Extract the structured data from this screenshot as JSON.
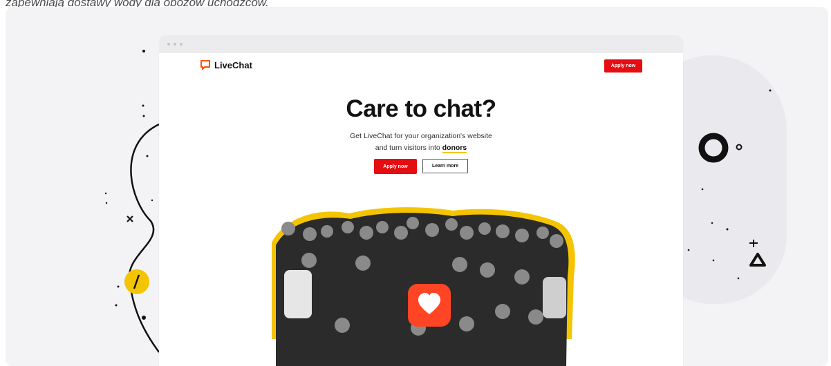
{
  "caption": "zapewniają dostawy wody dla obozów uchodźców.",
  "browser": {
    "logo_text": "LiveChat",
    "header_cta": "Apply now"
  },
  "hero": {
    "title": "Care to chat?",
    "subtitle_line1": "Get LiveChat for your organization's website",
    "subtitle_line2_prefix": "and turn visitors into ",
    "subtitle_highlight": "donors",
    "primary_cta": "Apply now",
    "secondary_cta": "Learn more"
  },
  "colors": {
    "brand_red": "#e40e12",
    "accent_yellow": "#f5c400",
    "background": "#f3f3f6"
  },
  "icons": [
    "livechat-logo-icon",
    "heart-icon"
  ]
}
